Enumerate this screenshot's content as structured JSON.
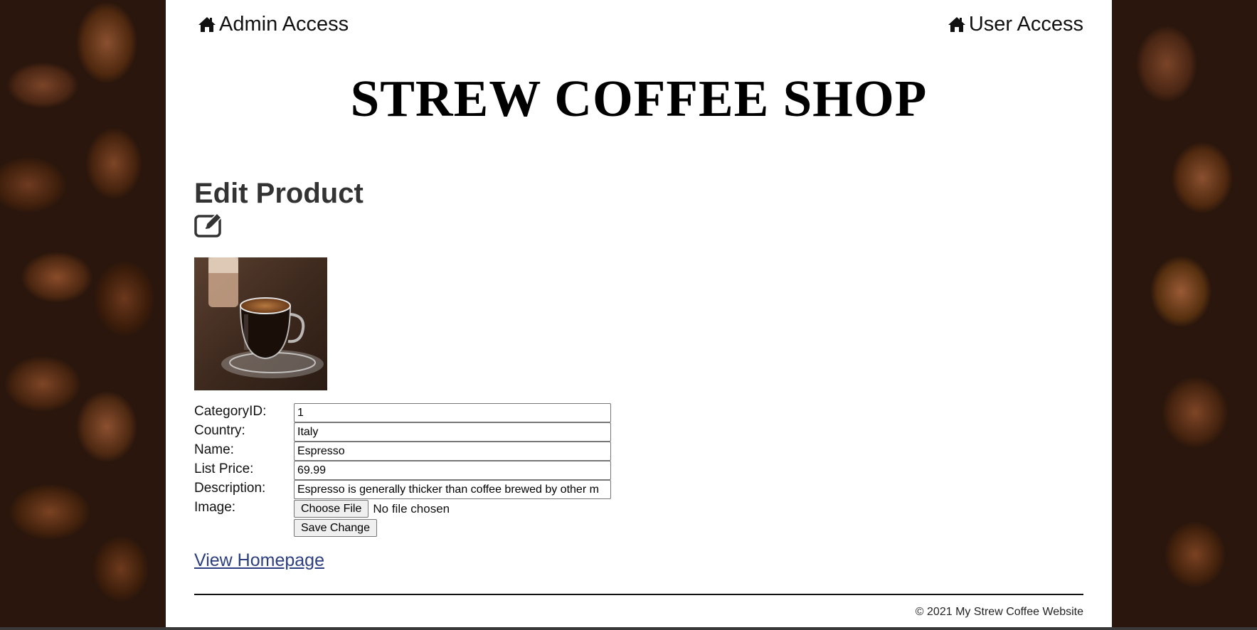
{
  "nav": {
    "admin_label": "Admin Access",
    "user_label": "User Access",
    "icon": "home-icon"
  },
  "site": {
    "title": "STREW COFFEE SHOP"
  },
  "page": {
    "heading": "Edit Product",
    "heading_icon": "edit-icon"
  },
  "form": {
    "category_label": "CategoryID:",
    "category_value": "1",
    "country_label": "Country:",
    "country_value": "Italy",
    "name_label": "Name:",
    "name_value": "Espresso",
    "price_label": "List Price:",
    "price_value": "69.99",
    "description_label": "Description:",
    "description_value": "Espresso is generally thicker than coffee brewed by other m",
    "image_label": "Image:",
    "choose_file_label": "Choose File",
    "file_status": "No file chosen",
    "save_label": "Save Change"
  },
  "links": {
    "homepage": "View Homepage"
  },
  "footer": {
    "copyright": "© 2021 My Strew Coffee Website"
  },
  "colors": {
    "link": "#2c3e80",
    "heading": "#333333",
    "background_beans": "#2a160c"
  }
}
